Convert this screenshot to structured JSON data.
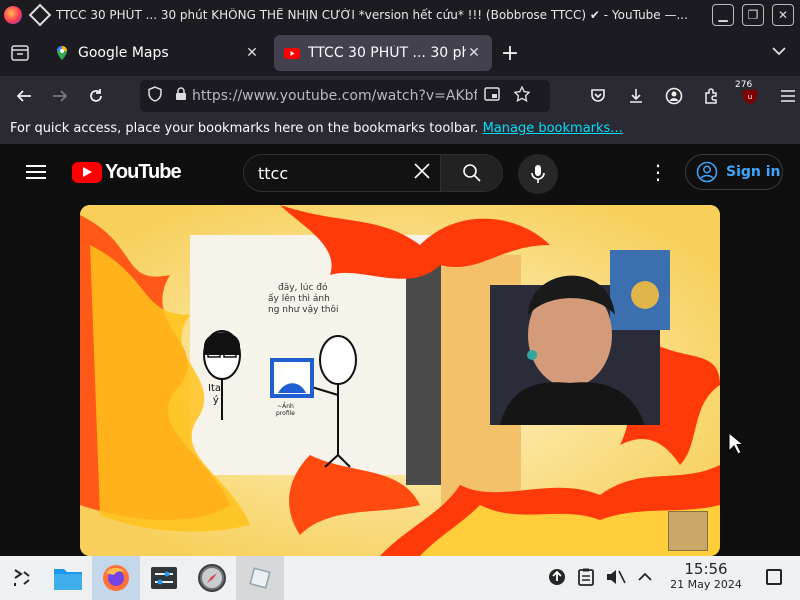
{
  "window": {
    "title": "TTCC 30 PHÚT ... 30 phút KHÔNG THỂ NHỊN CƯỜI *version hết cứu* !!! (Bobbrose TTCC) ✔ - YouTube —..."
  },
  "tabs": [
    {
      "label": "Google Maps",
      "favicon": "google-maps-icon",
      "active": false
    },
    {
      "label": "TTCC 30 PHÚT ... 30 phút",
      "favicon": "youtube-icon",
      "active": true
    }
  ],
  "navbar": {
    "url": "https://www.youtube.com/watch?v=AKbf",
    "extension_badge": "276"
  },
  "bookmarks_bar": {
    "message": "For quick access, place your bookmarks here on the bookmarks toolbar.",
    "link": "Manage bookmarks..."
  },
  "youtube": {
    "logo_text": "YouTube",
    "search_value": "ttcc",
    "sign_in": "Sign in"
  },
  "video": {
    "comic_text_1": "đây, lúc đó",
    "comic_text_2": "ấy lên thì ảnh",
    "comic_text_3": "ng như vậy thôi",
    "char_label": "Ital",
    "char_sublabel": "ý",
    "caption_small": "~Ảnh",
    "caption_small_2": "profile"
  },
  "taskbar": {
    "time": "15:56",
    "date": "21 May 2024"
  },
  "colors": {
    "accent_blue": "#3ea6ff",
    "youtube_red": "#ff0000",
    "link_cyan": "#00ddff"
  }
}
